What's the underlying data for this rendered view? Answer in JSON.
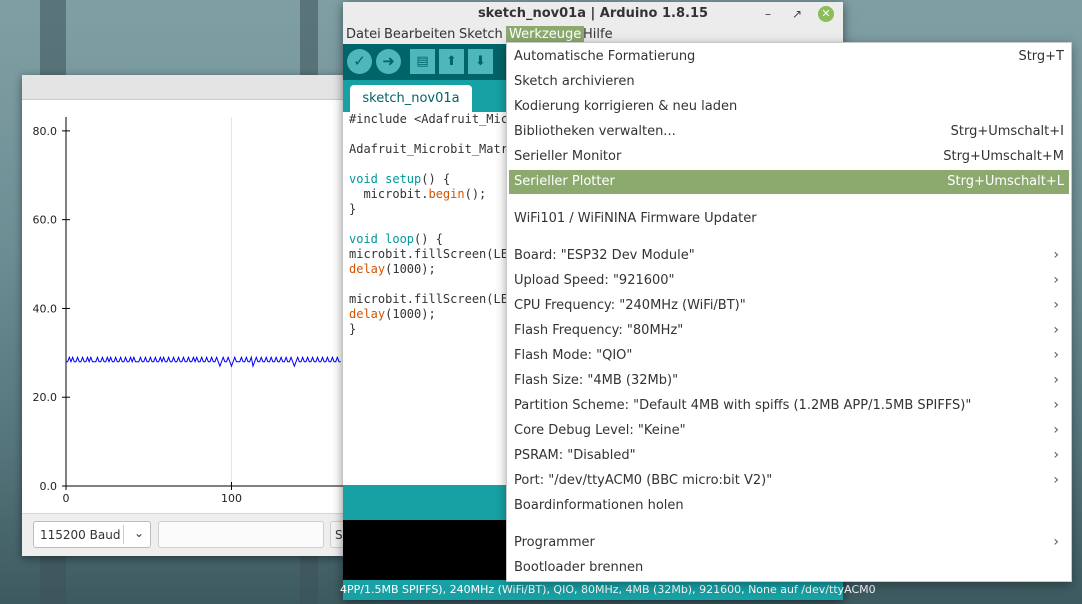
{
  "plotter": {
    "baud_value": "115200 Baud",
    "send_partial": "S"
  },
  "chart_data": {
    "type": "line",
    "x": [
      0,
      1,
      2,
      3,
      4,
      5,
      6,
      7,
      8,
      9,
      10,
      11,
      12,
      13,
      14,
      15,
      16,
      17,
      18,
      19,
      20,
      21,
      22,
      23,
      24,
      25,
      26,
      27,
      28,
      29,
      30,
      31,
      32,
      33,
      34,
      35,
      36,
      37,
      38,
      39,
      40,
      41,
      42,
      43,
      44,
      45,
      46,
      47,
      48,
      49,
      50,
      51,
      52,
      53,
      54,
      55,
      56,
      57,
      58,
      59,
      60,
      61,
      62,
      63,
      64,
      65,
      66,
      67,
      68,
      69,
      70,
      71,
      72,
      73,
      74,
      75,
      76,
      77,
      78,
      79,
      80,
      81,
      82,
      83,
      84,
      85,
      86,
      87,
      88,
      89,
      90,
      91,
      92,
      93,
      94,
      95,
      96,
      97,
      98,
      99,
      100,
      101,
      102,
      103,
      104,
      105,
      106,
      107,
      108,
      109,
      110,
      111,
      112,
      113,
      114,
      115,
      116,
      117,
      118,
      119,
      120,
      121,
      122,
      123,
      124,
      125,
      126,
      127,
      128,
      129,
      130,
      131,
      132,
      133,
      134,
      135,
      136,
      137,
      138,
      139,
      140,
      141,
      142,
      143,
      144,
      145,
      146,
      147,
      148,
      149,
      150,
      151,
      152,
      153,
      154,
      155,
      156,
      157,
      158,
      159,
      160,
      161,
      162,
      163,
      164,
      165,
      166
    ],
    "series": [
      {
        "values": [
          28,
          28,
          29,
          28,
          29,
          28,
          28,
          29,
          28,
          28,
          29,
          28,
          28,
          29,
          28,
          29,
          28,
          28,
          28,
          29,
          28,
          28,
          29,
          28,
          28,
          29,
          28,
          29,
          28,
          28,
          29,
          28,
          28,
          29,
          28,
          28,
          29,
          28,
          28,
          29,
          28,
          29,
          28,
          28,
          28,
          29,
          28,
          28,
          29,
          28,
          28,
          29,
          28,
          28,
          29,
          28,
          28,
          29,
          28,
          29,
          28,
          28,
          29,
          28,
          28,
          29,
          28,
          28,
          29,
          28,
          28,
          29,
          28,
          28,
          29,
          28,
          28,
          29,
          28,
          29,
          28,
          28,
          29,
          28,
          28,
          29,
          28,
          28,
          29,
          28,
          28,
          29,
          28,
          27,
          28,
          29,
          28,
          28,
          29,
          28,
          27,
          28,
          29,
          28,
          28,
          28,
          29,
          28,
          28,
          29,
          28,
          28,
          29,
          27,
          28,
          29,
          28,
          28,
          29,
          28,
          28,
          29,
          28,
          28,
          29,
          28,
          28,
          29,
          28,
          28,
          29,
          28,
          28,
          29,
          28,
          28,
          29,
          28,
          27,
          28,
          29,
          28,
          28,
          29,
          28,
          28,
          29,
          28,
          28,
          29,
          28,
          28,
          29,
          28,
          28,
          29,
          28,
          28,
          29,
          28,
          28,
          29,
          28,
          28,
          29,
          28,
          28
        ]
      }
    ],
    "xlim": [
      0,
      168
    ],
    "ylim": [
      0,
      82
    ],
    "xticks": [
      "0",
      "100"
    ],
    "yticks": [
      "0.0",
      "20.0",
      "40.0",
      "60.0",
      "80.0"
    ],
    "color": "#0000ff"
  },
  "ide": {
    "title": "sketch_nov01a | Arduino 1.8.15",
    "menus": [
      "Datei",
      "Bearbeiten",
      "Sketch",
      "Werkzeuge",
      "Hilfe"
    ],
    "tab": "sketch_nov01a",
    "code": {
      "l1": "#include <Adafruit_Micr",
      "l2": "Adafruit_Microbit_Matri",
      "l3a": "void",
      "l3b": " setup",
      "l3c": "() {",
      "l4a": "  microbit.",
      "l4b": "begin",
      "l4c": "();",
      "l5": "}",
      "l6a": "void",
      "l6b": " loop",
      "l6c": "() {",
      "l7": "microbit.fillScreen(LED",
      "l8a": "delay",
      "l8b": "(1000);",
      "l9": "microbit.fillScreen(LED",
      "l10a": "delay",
      "l10b": "(1000);",
      "l11": "}"
    },
    "status": "4PP/1.5MB SPIFFS), 240MHz (WiFi/BT), QIO, 80MHz, 4MB (32Mb), 921600, None auf /dev/ttyACM0",
    "colors": {
      "toolbar": "#006468",
      "accent": "#17a1a5",
      "highlight": "#8caa6e"
    }
  },
  "tools_menu": {
    "items": [
      {
        "label": "Automatische Formatierung",
        "shortcut": "Strg+T"
      },
      {
        "label": "Sketch archivieren",
        "shortcut": ""
      },
      {
        "label": "Kodierung korrigieren & neu laden",
        "shortcut": ""
      },
      {
        "label": "Bibliotheken verwalten...",
        "shortcut": "Strg+Umschalt+I"
      },
      {
        "label": "Serieller Monitor",
        "shortcut": "Strg+Umschalt+M"
      },
      {
        "label": "Serieller Plotter",
        "shortcut": "Strg+Umschalt+L"
      },
      {
        "label": "WiFi101 / WiFiNINA Firmware Updater",
        "shortcut": ""
      },
      {
        "label": "Board: \"ESP32 Dev Module\"",
        "shortcut": ""
      },
      {
        "label": "Upload Speed: \"921600\"",
        "shortcut": ""
      },
      {
        "label": "CPU Frequency: \"240MHz (WiFi/BT)\"",
        "shortcut": ""
      },
      {
        "label": "Flash Frequency: \"80MHz\"",
        "shortcut": ""
      },
      {
        "label": "Flash Mode: \"QIO\"",
        "shortcut": ""
      },
      {
        "label": "Flash Size: \"4MB (32Mb)\"",
        "shortcut": ""
      },
      {
        "label": "Partition Scheme: \"Default 4MB with spiffs (1.2MB APP/1.5MB SPIFFS)\"",
        "shortcut": ""
      },
      {
        "label": "Core Debug Level: \"Keine\"",
        "shortcut": ""
      },
      {
        "label": "PSRAM: \"Disabled\"",
        "shortcut": ""
      },
      {
        "label": "Port: \"/dev/ttyACM0 (BBC micro:bit V2)\"",
        "shortcut": ""
      },
      {
        "label": "Boardinformationen holen",
        "shortcut": ""
      },
      {
        "label": "Programmer",
        "shortcut": ""
      },
      {
        "label": "Bootloader brennen",
        "shortcut": ""
      }
    ]
  }
}
